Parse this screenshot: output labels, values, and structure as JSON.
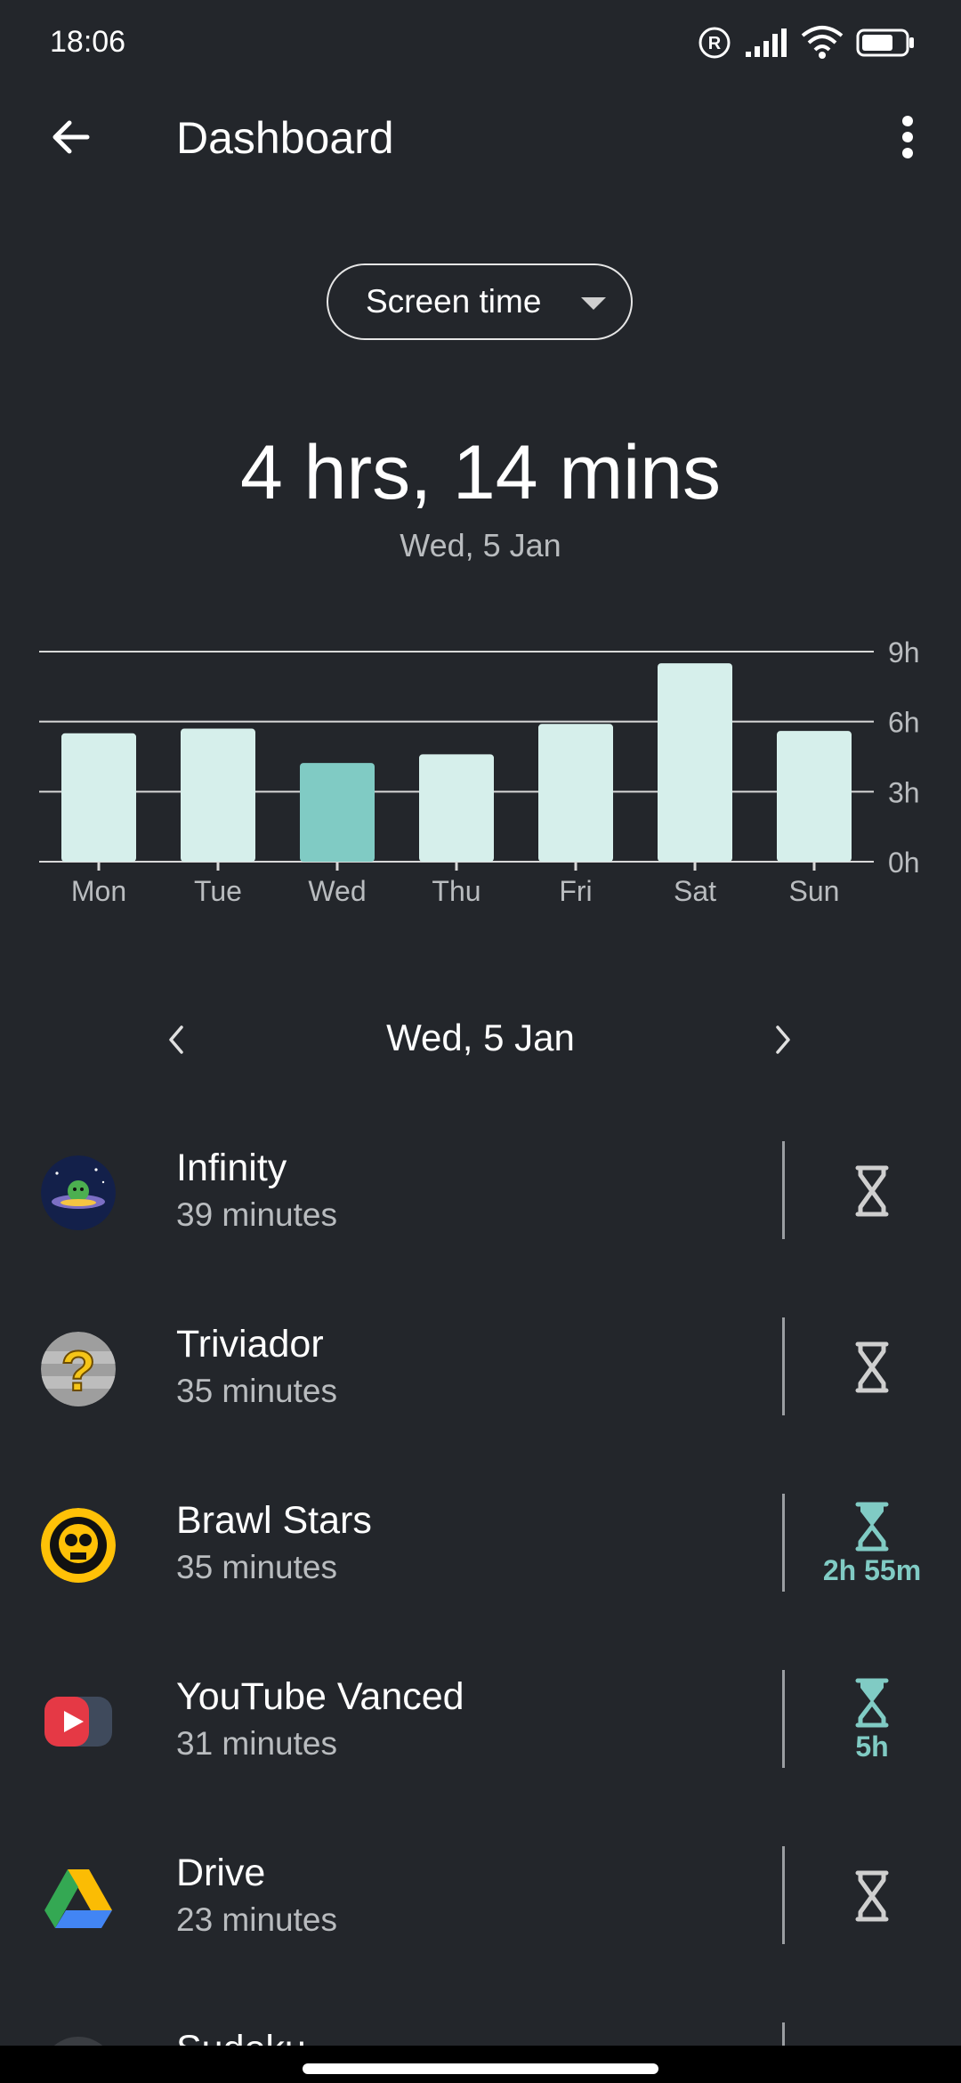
{
  "status_bar": {
    "time": "18:06",
    "icons": [
      "registered-icon",
      "signal-icon",
      "wifi-icon",
      "battery-icon"
    ]
  },
  "app_bar": {
    "title": "Dashboard",
    "back_icon": "arrow-back-icon",
    "menu_icon": "more-vert-icon"
  },
  "dropdown": {
    "selected": "Screen time"
  },
  "summary": {
    "total": "4 hrs, 14 mins",
    "date": "Wed, 5 Jan"
  },
  "chart_data": {
    "type": "bar",
    "categories": [
      "Mon",
      "Tue",
      "Wed",
      "Thu",
      "Fri",
      "Sat",
      "Sun"
    ],
    "values": [
      5.5,
      5.7,
      4.23,
      4.6,
      5.9,
      8.5,
      5.6
    ],
    "selected_index": 2,
    "y_ticks": [
      "0h",
      "3h",
      "6h",
      "9h"
    ],
    "ylim": [
      0,
      9
    ],
    "colors": {
      "bar": "#d6efeb",
      "selected": "#80cbc4",
      "grid": "#d9d9d9"
    }
  },
  "date_nav": {
    "date": "Wed, 5 Jan"
  },
  "apps": [
    {
      "name": "Infinity",
      "time": "39 minutes",
      "timer": "",
      "timer_active": false,
      "icon": "infinity-app-icon"
    },
    {
      "name": "Triviador",
      "time": "35 minutes",
      "timer": "",
      "timer_active": false,
      "icon": "triviador-app-icon"
    },
    {
      "name": "Brawl Stars",
      "time": "35 minutes",
      "timer": "2h 55m",
      "timer_active": true,
      "icon": "brawl-stars-app-icon"
    },
    {
      "name": "YouTube Vanced",
      "time": "31 minutes",
      "timer": "5h",
      "timer_active": true,
      "icon": "youtube-vanced-app-icon"
    },
    {
      "name": "Drive",
      "time": "23 minutes",
      "timer": "",
      "timer_active": false,
      "icon": "drive-app-icon"
    },
    {
      "name": "Sudoku",
      "time": "",
      "timer": "",
      "timer_active": false,
      "icon": "sudoku-app-icon"
    }
  ],
  "colors": {
    "background": "#23262b",
    "accent": "#80cbc4",
    "secondary_text": "#b9bcbf"
  }
}
